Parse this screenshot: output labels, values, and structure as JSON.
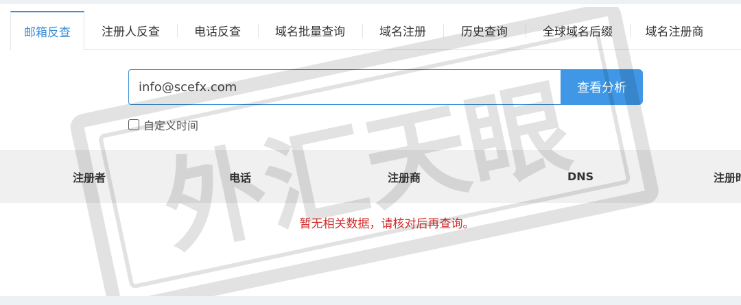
{
  "tabs": [
    {
      "label": "邮箱反查",
      "active": true
    },
    {
      "label": "注册人反查"
    },
    {
      "label": "电话反查"
    },
    {
      "label": "域名批量查询"
    },
    {
      "label": "域名注册"
    },
    {
      "label": "历史查询"
    },
    {
      "label": "全球域名后缀"
    },
    {
      "label": "域名注册商"
    }
  ],
  "search": {
    "value": "info@scefx.com",
    "button_label": "查看分析"
  },
  "filters": {
    "custom_time_label": "自定义时间",
    "custom_time_checked": false
  },
  "table": {
    "columns": [
      "注册者",
      "电话",
      "注册商",
      "DNS",
      "注册时间"
    ]
  },
  "empty_message": "暂无相关数据，请核对后再查询。",
  "watermark_text": "外汇天眼",
  "colors": {
    "accent": "#3a8ed8",
    "button": "#3f97e6",
    "error": "#d22b2b",
    "header_bg": "#f0f0f0"
  }
}
